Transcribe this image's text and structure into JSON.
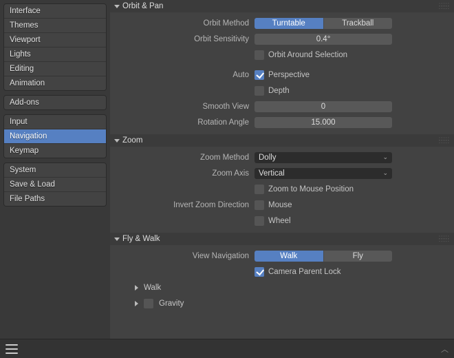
{
  "sidebar": {
    "groups": [
      [
        "Interface",
        "Themes",
        "Viewport",
        "Lights",
        "Editing",
        "Animation"
      ],
      [
        "Add-ons"
      ],
      [
        "Input",
        "Navigation",
        "Keymap"
      ],
      [
        "System",
        "Save & Load",
        "File Paths"
      ]
    ],
    "active": "Navigation"
  },
  "panels": {
    "orbit": {
      "title": "Orbit & Pan",
      "orbit_method_label": "Orbit Method",
      "orbit_method_options": [
        "Turntable",
        "Trackball"
      ],
      "orbit_method_sel": 0,
      "orbit_sens_label": "Orbit Sensitivity",
      "orbit_sens_value": "0.4°",
      "orbit_around_sel": "Orbit Around Selection",
      "orbit_around_sel_on": false,
      "auto_label": "Auto",
      "auto_perspective": "Perspective",
      "auto_perspective_on": true,
      "auto_depth": "Depth",
      "auto_depth_on": false,
      "smooth_view_label": "Smooth View",
      "smooth_view_value": "0",
      "rot_angle_label": "Rotation Angle",
      "rot_angle_value": "15.000"
    },
    "zoom": {
      "title": "Zoom",
      "method_label": "Zoom Method",
      "method_value": "Dolly",
      "axis_label": "Zoom Axis",
      "axis_value": "Vertical",
      "to_mouse": "Zoom to Mouse Position",
      "to_mouse_on": false,
      "invert_label": "Invert Zoom Direction",
      "invert_mouse": "Mouse",
      "invert_mouse_on": false,
      "invert_wheel": "Wheel",
      "invert_wheel_on": false
    },
    "flywalk": {
      "title": "Fly & Walk",
      "viewnav_label": "View Navigation",
      "viewnav_options": [
        "Walk",
        "Fly"
      ],
      "viewnav_sel": 0,
      "cam_parent": "Camera Parent Lock",
      "cam_parent_on": true,
      "sub_walk": "Walk",
      "sub_gravity": "Gravity",
      "sub_gravity_on": false
    }
  }
}
